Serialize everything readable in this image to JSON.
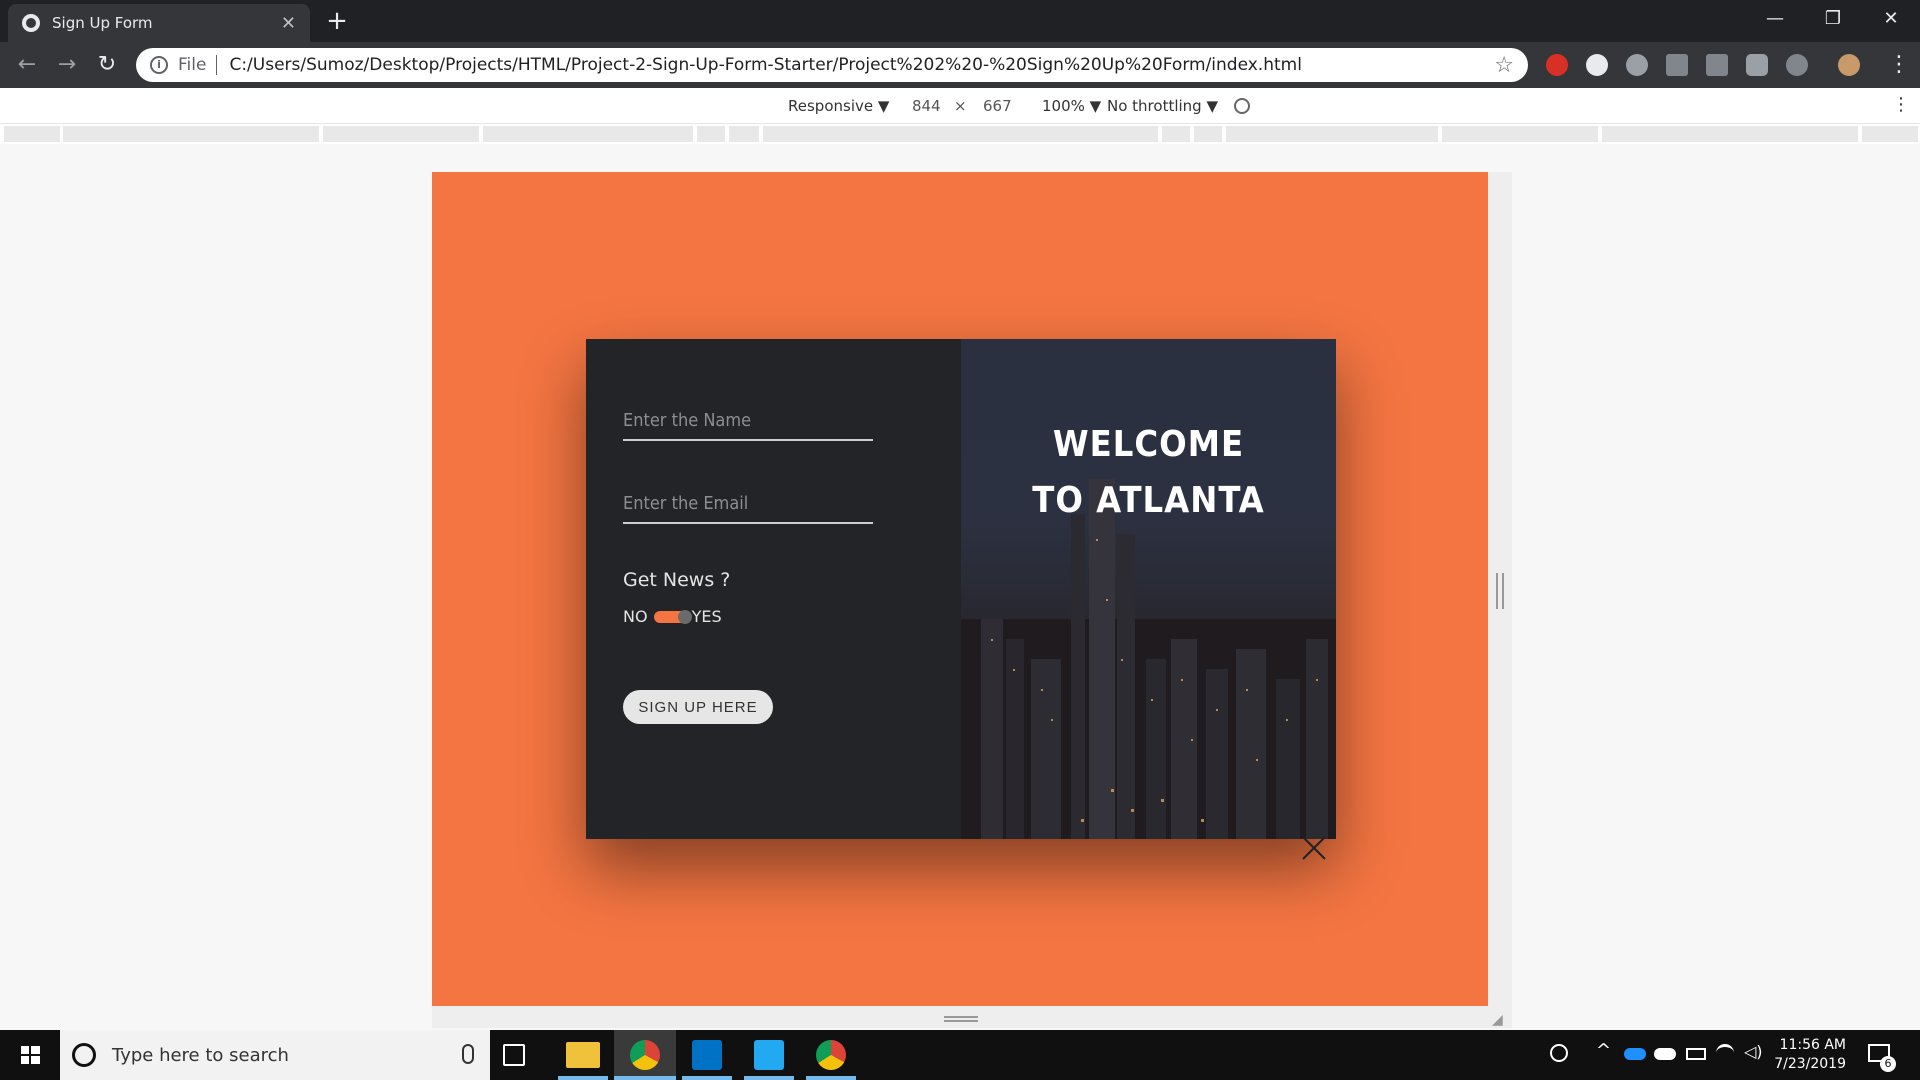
{
  "browser": {
    "tab_title": "Sign Up Form",
    "tab_close": "✕",
    "new_tab": "+",
    "window_controls": {
      "minimize": "—",
      "restore": "❐",
      "close": "✕"
    },
    "nav": {
      "back": "←",
      "forward": "→",
      "reload": "↻"
    },
    "address": {
      "info": "i",
      "scheme": "File",
      "url": "C:/Users/Sumoz/Desktop/Projects/HTML/Project-2-Sign-Up-Form-Starter/Project%202%20-%20Sign%20Up%20Form/index.html",
      "bookmark": "☆"
    }
  },
  "device_toolbar": {
    "mode": "Responsive ▼",
    "width": "844",
    "times": "×",
    "height": "667",
    "zoom": "100% ▼",
    "throttling": "No throttling ▼",
    "more": "⋮"
  },
  "form": {
    "name_placeholder": "Enter the Name",
    "email_placeholder": "Enter the Email",
    "news_label": "Get News ?",
    "toggle_no": "NO",
    "toggle_yes": "YES",
    "toggle_on": true,
    "submit_label": "SIGN UP HERE"
  },
  "welcome": {
    "line1": "WELCOME",
    "line2": "TO ATLANTA"
  },
  "colors": {
    "page_bg": "#f47542",
    "panel_dark": "#232428",
    "accent": "#f47542"
  },
  "taskbar": {
    "search_placeholder": "Type here to search",
    "time": "11:56 AM",
    "date": "7/23/2019",
    "notifications": "6"
  }
}
